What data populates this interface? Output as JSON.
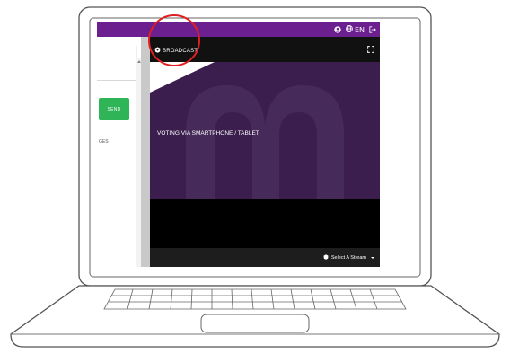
{
  "topbar": {
    "language": "EN",
    "icons": [
      "user-icon",
      "globe-icon",
      "logout-icon"
    ]
  },
  "chat": {
    "send_label": "SEND",
    "partial_label": "GES"
  },
  "broadcast": {
    "title": "BROADCAST",
    "slide_text": "VOTING VIA SMARTPHONE / TABLET",
    "stream_select": "Select A Stream"
  },
  "colors": {
    "topbar": "#6c1f8e",
    "send": "#2fb457",
    "slide_bg": "#3b1e4d",
    "highlight_circle": "#e02020"
  }
}
